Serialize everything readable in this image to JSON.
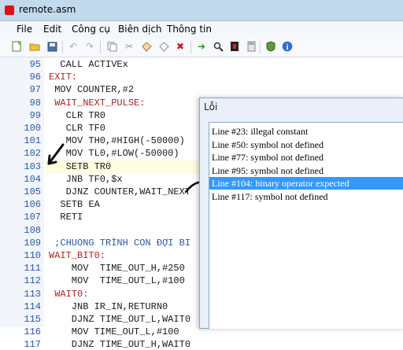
{
  "window": {
    "title": "remote.asm"
  },
  "menu": [
    "File",
    "Edit",
    "Công cụ",
    "Biên dịch",
    "Thông tin"
  ],
  "toolbar": {
    "icons": [
      "new-file-icon",
      "open-folder-icon",
      "save-icon",
      "undo-icon",
      "redo-icon",
      "copy-icon",
      "cut-icon",
      "paste-icon",
      "clear-icon",
      "delete-icon",
      "run-icon",
      "find-icon",
      "chip-icon",
      "calculator-icon",
      "shield-icon",
      "info-icon"
    ]
  },
  "editor": {
    "lines": [
      {
        "n": "95",
        "t": "  CALL ACTIVEx",
        "c": "#1a1a1a"
      },
      {
        "n": "96",
        "t": "EXIT:",
        "c": "#b21f1f"
      },
      {
        "n": "97",
        "t": " MOV COUNTER,#2",
        "c": "#1a1a1a"
      },
      {
        "n": "98",
        "t": " WAIT_NEXT_PULSE:",
        "c": "#b21f1f"
      },
      {
        "n": "99",
        "t": "   CLR TR0",
        "c": "#1a1a1a"
      },
      {
        "n": "100",
        "t": "   CLR TF0",
        "c": "#1a1a1a"
      },
      {
        "n": "101",
        "t": "   MOV TH0,#HIGH(-50000)",
        "c": "#1a1a1a"
      },
      {
        "n": "102",
        "t": "   MOV TL0,#LOW(-50000)",
        "c": "#1a1a1a"
      },
      {
        "n": "103",
        "t": "   SETB TR0",
        "c": "#1a1a1a"
      },
      {
        "n": "104",
        "t": "   JNB TF0,$x",
        "c": "#1a1a1a"
      },
      {
        "n": "105",
        "t": "   DJNZ COUNTER,WAIT_NEXT",
        "c": "#1a1a1a"
      },
      {
        "n": "106",
        "t": "  SETB EA",
        "c": "#1a1a1a"
      },
      {
        "n": "107",
        "t": "  RETI",
        "c": "#1a1a1a"
      },
      {
        "n": "108",
        "t": "",
        "c": "#1a1a1a"
      },
      {
        "n": "109",
        "t": " ;CHUONG TRÌNH CON ĐỢI BI",
        "c": "#2d56a8"
      },
      {
        "n": "110",
        "t": "WAIT_BIT0:",
        "c": "#b21f1f"
      },
      {
        "n": "111",
        "t": "    MOV  TIME_OUT_H,#250",
        "c": "#1a1a1a"
      },
      {
        "n": "112",
        "t": "    MOV  TIME_OUT_L,#100",
        "c": "#1a1a1a"
      },
      {
        "n": "113",
        "t": " WAIT0:",
        "c": "#b21f1f"
      },
      {
        "n": "114",
        "t": "    JNB IR_IN,RETURN0",
        "c": "#1a1a1a"
      },
      {
        "n": "115",
        "t": "    DJNZ TIME_OUT_L,WAIT0",
        "c": "#1a1a1a"
      },
      {
        "n": "116",
        "t": "    MOV TIME_OUT_L,#100",
        "c": "#1a1a1a"
      },
      {
        "n": "117",
        "t": "    DJNZ TIME_OUT_H,WAIT0",
        "c": "#1a1a1a"
      }
    ]
  },
  "errors": {
    "title": "Lỗi",
    "items": [
      "Line #23: illegal constant",
      "Line #50: symbol not defined",
      "Line #77: symbol not defined",
      "Line #95: symbol not defined",
      "Line #104: binary operator expected",
      "Line #117: symbol not defined"
    ],
    "selected_index": 4
  }
}
